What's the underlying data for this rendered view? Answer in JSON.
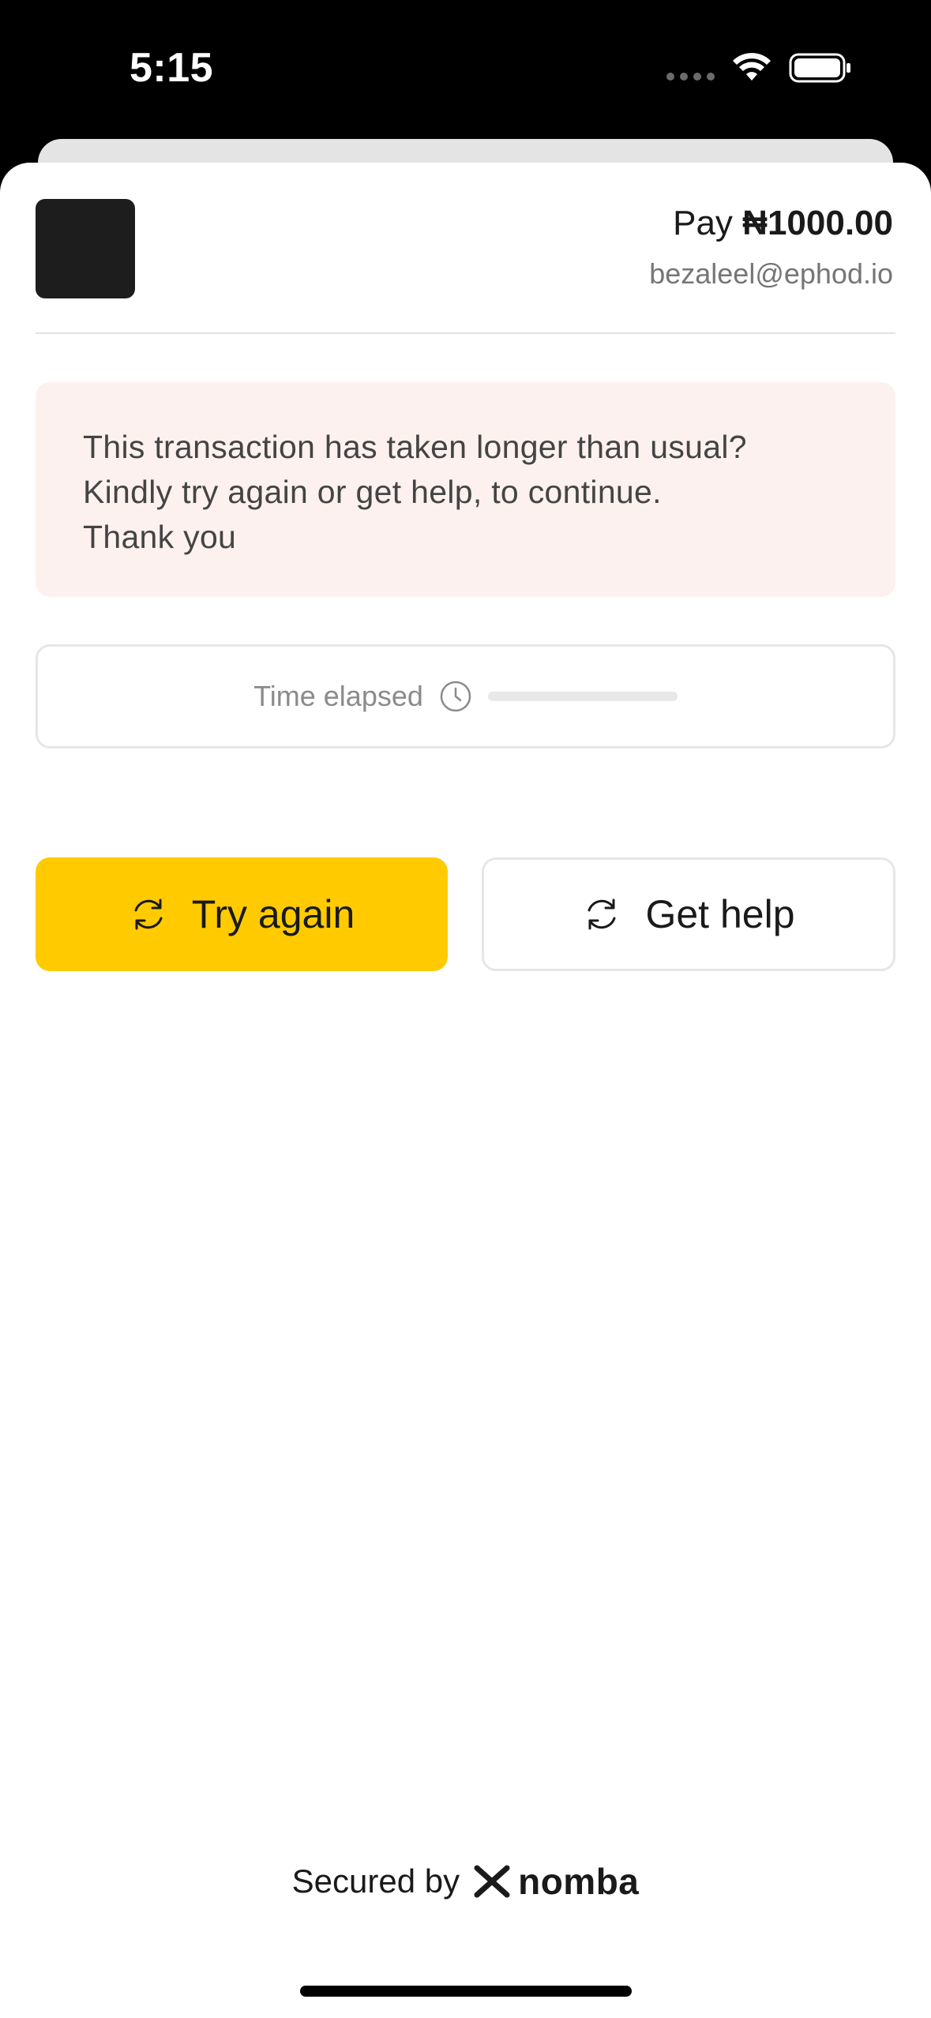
{
  "status_bar": {
    "time": "5:15"
  },
  "header": {
    "pay_prefix": "Pay",
    "currency_symbol": "₦",
    "amount": "1000.00",
    "email": "bezaleel@ephod.io"
  },
  "notice": {
    "message": "This transaction has taken longer than usual?\n Kindly try again or get help, to continue.\nThank you"
  },
  "timer": {
    "label": "Time elapsed",
    "icon": "clock-icon",
    "progress_fraction": 0.0
  },
  "actions": {
    "try_again_label": "Try again",
    "try_again_icon": "refresh-icon",
    "get_help_label": "Get help",
    "get_help_icon": "refresh-icon"
  },
  "footer": {
    "secured_by": "Secured by",
    "brand_name": "nomba"
  },
  "colors": {
    "accent": "#ffcb00",
    "notice_background": "#fdf1ef",
    "logo_placeholder": "#1d1d1d"
  }
}
